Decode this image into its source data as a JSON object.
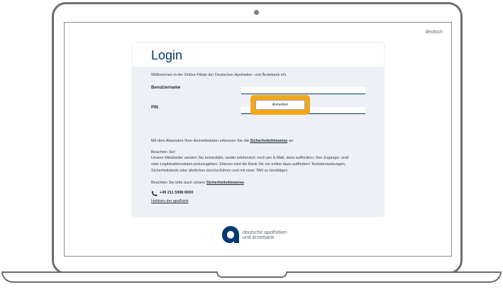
{
  "language_link": "deutsch",
  "login": {
    "title": "Login",
    "welcome": "Willkommen in der Online-Filiale der Deutschen Apotheker- und Ärztebank eG.",
    "username_label": "Benutzername",
    "username_value": "",
    "pin_label": "PIN",
    "pin_value": "",
    "submit_label": "Anmelden"
  },
  "notice": {
    "consent_prefix": "Mit dem Absenden Ihrer Anmeldedaten erkennen Sie die",
    "consent_link": "Sicherheitshinweise",
    "consent_suffix": "an.",
    "heading": "Beachten Sie!",
    "line1": "Unsere Mitarbeiter werden Sie keinesfalls, weder telefonisch noch per E-Mail, dazu auffordern, Ihre Zugangs- und/",
    "line2": "oder Legitimationsdaten preiszugeben. Ebenso wird die Bank Sie nie online dazu auffordern Testüberweisungen,",
    "line3": "Sicherheitstests oder ähnliches durchzuführen und mit einer TAN zu bestätigen.",
    "also_prefix": "Beachten Sie bitte auch unsere",
    "also_link": "Sicherheitshinweise",
    "also_suffix": "."
  },
  "contact": {
    "phone": "+49 211 5998 8000",
    "hotlines_link": "Hotlines der apoBank",
    "icon": "phone-icon"
  },
  "footer": {
    "logo_line1": "deutsche apotheker-",
    "logo_line2": "und ärztebank"
  },
  "colors": {
    "brand_blue": "#003a70",
    "highlight_orange": "#f2a71b",
    "card_background": "#edf1f5",
    "device_frame": "#6e6e6e"
  }
}
